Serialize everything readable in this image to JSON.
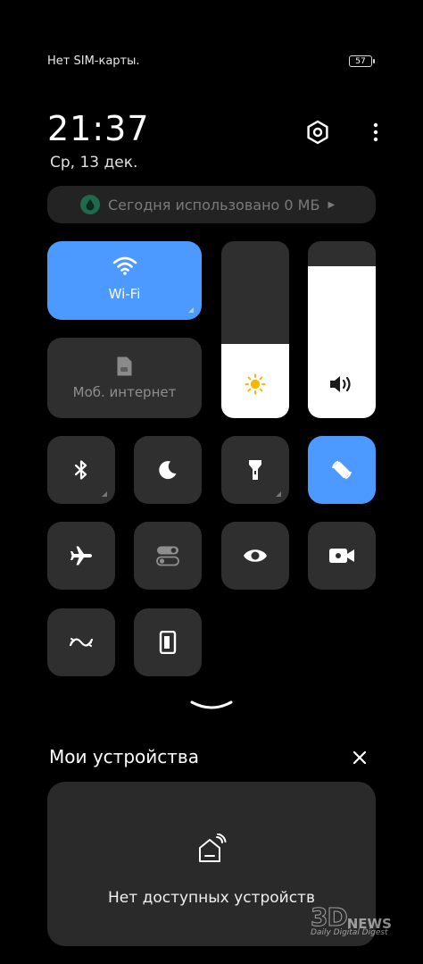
{
  "status": {
    "carrier": "Нет SIM-карты.",
    "battery": "57"
  },
  "clock": {
    "time": "21:37",
    "date": "Ср, 13 дек."
  },
  "data_usage": {
    "label": "Сегодня использовано 0 МБ"
  },
  "tiles": {
    "wifi": {
      "label": "Wi-Fi",
      "active": true
    },
    "mobile_data": {
      "label": "Моб. интернет",
      "active": false
    }
  },
  "sliders": {
    "brightness_level": 0.42,
    "volume_level": 0.84
  },
  "toggles": [
    {
      "name": "bluetooth",
      "icon": "bluetooth-icon",
      "active": false
    },
    {
      "name": "dark-mode",
      "icon": "moon-icon",
      "active": false
    },
    {
      "name": "flashlight",
      "icon": "flashlight-icon",
      "active": false
    },
    {
      "name": "auto-rotate",
      "icon": "rotate-icon",
      "active": true
    },
    {
      "name": "airplane-mode",
      "icon": "airplane-icon",
      "active": false
    },
    {
      "name": "toggle-switch",
      "icon": "toggle-icon",
      "active": false
    },
    {
      "name": "eye-comfort",
      "icon": "eye-icon",
      "active": false
    },
    {
      "name": "screen-record",
      "icon": "video-camera-icon",
      "active": false
    },
    {
      "name": "nfc",
      "icon": "nfc-icon",
      "active": false
    },
    {
      "name": "one-hand-mode",
      "icon": "one-hand-icon",
      "active": false
    }
  ],
  "devices": {
    "title": "Мои устройства",
    "empty": "Нет доступных устройств"
  },
  "watermark": {
    "brand": "3D",
    "news": "NEWS",
    "tagline": "Daily Digital Digest"
  },
  "colors": {
    "accent": "#4c9aff",
    "tile": "#2f2f2f",
    "background": "#000000"
  }
}
